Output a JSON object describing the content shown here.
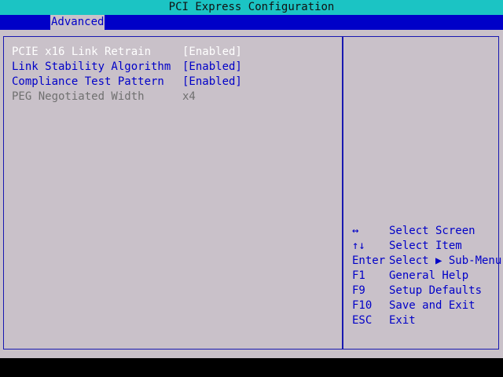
{
  "title": "PCI Express Configuration",
  "tabs": [
    {
      "label": "Advanced"
    }
  ],
  "settings": [
    {
      "label": "PCIE x16 Link Retrain",
      "value": "[Enabled]"
    },
    {
      "label": "Link Stability Algorithm",
      "value": "[Enabled]"
    },
    {
      "label": "Compliance Test Pattern",
      "value": "[Enabled]"
    },
    {
      "label": "PEG Negotiated Width",
      "value": "x4"
    }
  ],
  "help_keys": [
    {
      "key": "↔",
      "action": "Select Screen"
    },
    {
      "key": "↑↓",
      "action": "Select Item"
    },
    {
      "key": "Enter",
      "action": "Select ▶ Sub-Menu"
    },
    {
      "key": "F1",
      "action": "General Help"
    },
    {
      "key": "F9",
      "action": "Setup Defaults"
    },
    {
      "key": "F10",
      "action": "Save and Exit"
    },
    {
      "key": "ESC",
      "action": "Exit"
    }
  ],
  "colors": {
    "title_bar": "#1bc4c4",
    "tab_bar": "#0000c8",
    "panel_bg": "#c9c1c9",
    "selected_text": "#ffffff",
    "option_text": "#0000c8",
    "readonly_text": "#707070"
  }
}
